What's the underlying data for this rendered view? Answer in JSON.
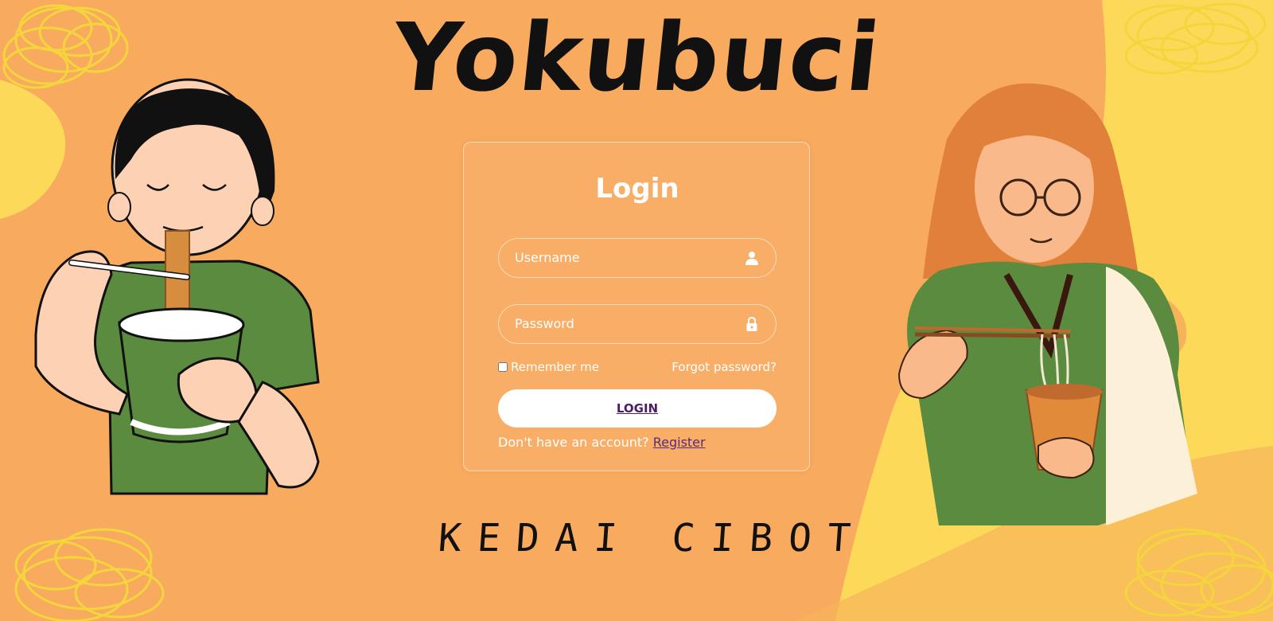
{
  "brand": {
    "title": "Yokubuci",
    "subtitle": "KEDAI CIBOT"
  },
  "login_form": {
    "heading": "Login",
    "username_placeholder": "Username",
    "username_icon": "user-icon",
    "password_placeholder": "Password",
    "password_icon": "lock-icon",
    "remember_label": "Remember me",
    "remember_checked": false,
    "forgot_label": "Forgot password?",
    "submit_label": "LOGIN",
    "register_prompt": "Don't have an account?",
    "register_label": "Register"
  },
  "colors": {
    "background": "#f8aa5f",
    "accent_yellow": "#fdd95a",
    "link_purple": "#5a2a7a",
    "text_white": "#ffffff"
  }
}
